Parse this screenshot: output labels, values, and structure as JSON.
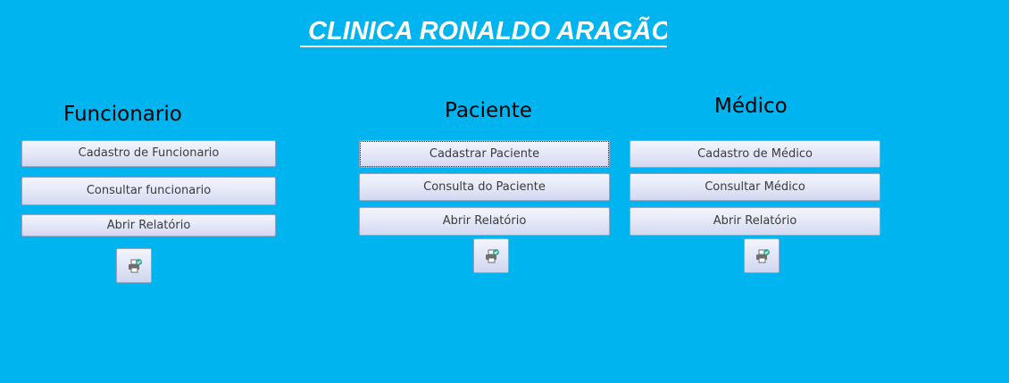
{
  "header": {
    "title": "CLINICA RONALDO ARAGÃO"
  },
  "sections": {
    "funcionario": {
      "heading": "Funcionario",
      "buttons": {
        "cadastro": "Cadastro de Funcionario",
        "consultar": "Consultar funcionario",
        "relatorio": "Abrir Relatório"
      },
      "print_icon": "print-report-icon"
    },
    "paciente": {
      "heading": "Paciente",
      "buttons": {
        "cadastro": "Cadastrar Paciente",
        "consultar": "Consulta do Paciente",
        "relatorio": "Abrir Relatório"
      },
      "print_icon": "print-report-icon"
    },
    "medico": {
      "heading": "Médico",
      "buttons": {
        "cadastro": "Cadastro de Médico",
        "consultar": "Consultar Médico",
        "relatorio": "Abrir Relatório"
      },
      "print_icon": "print-report-icon"
    }
  },
  "colors": {
    "background": "#00b4ef",
    "title": "#ffffff",
    "button_border": "#95a3c4"
  }
}
